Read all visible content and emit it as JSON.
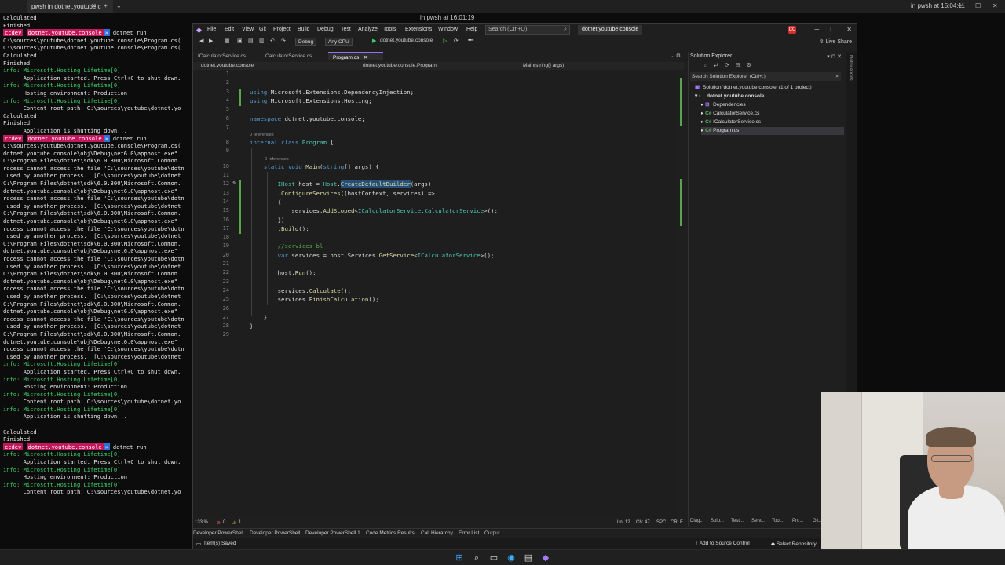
{
  "terminal": {
    "tab_title": "pwsh in dotnet.youtube.c",
    "mid_title": "in pwsh at 16:01:19",
    "right_title": "in pwsh at 15:04:11",
    "lines": [
      {
        "t": "Calculated"
      },
      {
        "t": "Finished"
      },
      {
        "t": "prompt",
        "a": "ccdev",
        "b": "dotnet.youtube.console",
        "c": "dotnet run"
      },
      {
        "t": "C:\\sources\\youtube\\dotnet.youtube.console\\Program.cs("
      },
      {
        "t": "C:\\sources\\youtube\\dotnet.youtube.console\\Program.cs("
      },
      {
        "t": "Calculated"
      },
      {
        "t": "Finished"
      },
      {
        "t": "info: Microsoft.Hosting.Lifetime[0]"
      },
      {
        "t": "      Application started. Press Ctrl+C to shut down."
      },
      {
        "t": "info: Microsoft.Hosting.Lifetime[0]"
      },
      {
        "t": "      Hosting environment: Production"
      },
      {
        "t": "info: Microsoft.Hosting.Lifetime[0]"
      },
      {
        "t": "      Content root path: C:\\sources\\youtube\\dotnet.yo"
      },
      {
        "t": "Calculated"
      },
      {
        "t": "Finished"
      },
      {
        "t": "      Application is shutting down..."
      },
      {
        "t": "prompt",
        "a": "ccdev",
        "b": "dotnet.youtube.console",
        "c": "dotnet run"
      },
      {
        "t": "C:\\sources\\youtube\\dotnet.youtube.console\\Program.cs("
      },
      {
        "t": "dotnet.youtube.console\\obj\\Debug\\net6.0\\apphost.exe\""
      },
      {
        "t": "C:\\Program Files\\dotnet\\sdk\\6.0.300\\Microsoft.Common."
      },
      {
        "t": "rocess cannot access the file 'C:\\sources\\youtube\\dotn"
      },
      {
        "t": " used by another process.  [C:\\sources\\youtube\\dotnet"
      },
      {
        "t": "C:\\Program Files\\dotnet\\sdk\\6.0.300\\Microsoft.Common."
      },
      {
        "t": "dotnet.youtube.console\\obj\\Debug\\net6.0\\apphost.exe\""
      },
      {
        "t": "rocess cannot access the file 'C:\\sources\\youtube\\dotn"
      },
      {
        "t": " used by another process.  [C:\\sources\\youtube\\dotnet"
      },
      {
        "t": "C:\\Program Files\\dotnet\\sdk\\6.0.300\\Microsoft.Common."
      },
      {
        "t": "dotnet.youtube.console\\obj\\Debug\\net6.0\\apphost.exe\""
      },
      {
        "t": "rocess cannot access the file 'C:\\sources\\youtube\\dotn"
      },
      {
        "t": " used by another process.  [C:\\sources\\youtube\\dotnet"
      },
      {
        "t": "C:\\Program Files\\dotnet\\sdk\\6.0.300\\Microsoft.Common."
      },
      {
        "t": "dotnet.youtube.console\\obj\\Debug\\net6.0\\apphost.exe\""
      },
      {
        "t": "rocess cannot access the file 'C:\\sources\\youtube\\dotn"
      },
      {
        "t": " used by another process.  [C:\\sources\\youtube\\dotnet"
      },
      {
        "t": "C:\\Program Files\\dotnet\\sdk\\6.0.300\\Microsoft.Common."
      },
      {
        "t": "dotnet.youtube.console\\obj\\Debug\\net6.0\\apphost.exe\""
      },
      {
        "t": "rocess cannot access the file 'C:\\sources\\youtube\\dotn"
      },
      {
        "t": " used by another process.  [C:\\sources\\youtube\\dotnet"
      },
      {
        "t": "C:\\Program Files\\dotnet\\sdk\\6.0.300\\Microsoft.Common."
      },
      {
        "t": "dotnet.youtube.console\\obj\\Debug\\net6.0\\apphost.exe\""
      },
      {
        "t": "rocess cannot access the file 'C:\\sources\\youtube\\dotn"
      },
      {
        "t": " used by another process.  [C:\\sources\\youtube\\dotnet"
      },
      {
        "t": "C:\\Program Files\\dotnet\\sdk\\6.0.300\\Microsoft.Common."
      },
      {
        "t": "dotnet.youtube.console\\obj\\Debug\\net6.0\\apphost.exe\""
      },
      {
        "t": "rocess cannot access the file 'C:\\sources\\youtube\\dotn"
      },
      {
        "t": " used by another process.  [C:\\sources\\youtube\\dotnet"
      },
      {
        "t": "info: Microsoft.Hosting.Lifetime[0]"
      },
      {
        "t": "      Application started. Press Ctrl+C to shut down."
      },
      {
        "t": "info: Microsoft.Hosting.Lifetime[0]"
      },
      {
        "t": "      Hosting environment: Production"
      },
      {
        "t": "info: Microsoft.Hosting.Lifetime[0]"
      },
      {
        "t": "      Content root path: C:\\sources\\youtube\\dotnet.yo"
      },
      {
        "t": "info: Microsoft.Hosting.Lifetime[0]"
      },
      {
        "t": "      Application is shutting down..."
      },
      {
        "t": ""
      },
      {
        "t": "Calculated"
      },
      {
        "t": "Finished"
      },
      {
        "t": "prompt",
        "a": "ccdev",
        "b": "dotnet.youtube.console",
        "c": "dotnet run"
      },
      {
        "t": "info: Microsoft.Hosting.Lifetime[0]"
      },
      {
        "t": "      Application started. Press Ctrl+C to shut down."
      },
      {
        "t": "info: Microsoft.Hosting.Lifetime[0]"
      },
      {
        "t": "      Hosting environment: Production"
      },
      {
        "t": "info: Microsoft.Hosting.Lifetime[0]"
      },
      {
        "t": "      Content root path: C:\\sources\\youtube\\dotnet.yo"
      }
    ]
  },
  "vs": {
    "menu": [
      "File",
      "Edit",
      "View",
      "Git",
      "Project",
      "Build",
      "Debug",
      "Test",
      "Analyze",
      "Tools",
      "Extensions",
      "Window",
      "Help"
    ],
    "search_placeholder": "Search (Ctrl+Q)",
    "solution_title": "dotnet.youtube.console",
    "badge": "CC",
    "live_share": "Live Share",
    "config": "Debug",
    "platform": "Any CPU",
    "run_target": "dotnet.youtube.console",
    "tabs": [
      "ICalculatorService.cs",
      "CalculatorService.cs",
      "Program.cs"
    ],
    "nav": {
      "project": "dotnet.youtube.console",
      "type": "dotnet.youtube.console.Program",
      "member": "Main(string[] args)"
    },
    "code_lines": [
      "",
      "",
      "using Microsoft.Extensions.DependencyInjection;",
      "using Microsoft.Extensions.Hosting;",
      "",
      "namespace dotnet.youtube.console;",
      "",
      "internal class Program {",
      "",
      "    static void Main(string[] args) {",
      "",
      "        IHost host = Host.CreateDefaultBuilder(args)",
      "        .ConfigureServices((hostContext, services) =>",
      "        {",
      "            services.AddScoped<ICalculatorService,CalculatorService>();",
      "        })",
      "        .Build();",
      "",
      "        //services bl",
      "        var services = host.Services.GetService<ICalculatorService>();",
      "",
      "        host.Run();",
      "",
      "        services.Calculate();",
      "        services.FinishCalculation();",
      "",
      "    }",
      "}",
      ""
    ],
    "codelens": [
      "0 references",
      "0 references"
    ],
    "status_editor": {
      "zoom": "133 %",
      "errors": "0",
      "warnings": "1",
      "ln": "Ln: 12",
      "ch": "Ch: 47",
      "spc": "SPC",
      "crlf": "CRLF"
    },
    "bottom_tabs": [
      "Developer PowerShell",
      "Developer PowerShell",
      "Developer PowerShell 1",
      "Code Metrics Results",
      "Call Hierarchy",
      "Error List",
      "Output"
    ],
    "status": {
      "left": "Item(s) Saved",
      "source": "Add to Source Control",
      "repo": "Select Repository"
    }
  },
  "solution_explorer": {
    "title": "Solution Explorer",
    "search": "Search Solution Explorer (Ctrl+;)",
    "items": [
      {
        "label": "Solution 'dotnet.youtube.console' (1 of 1 project)",
        "icon": "solution-icon"
      },
      {
        "label": "dotnet.youtube.console",
        "icon": "project-icon"
      },
      {
        "label": "Dependencies",
        "icon": "dependencies-icon"
      },
      {
        "label": "CalculatorService.cs",
        "icon": "csharp-file-icon"
      },
      {
        "label": "ICalculatorService.cs",
        "icon": "csharp-file-icon"
      },
      {
        "label": "Program.cs",
        "icon": "csharp-file-icon"
      }
    ],
    "bottom_tabs": [
      "Diag...",
      "Solu...",
      "Test...",
      "Serv...",
      "Tool...",
      "Pro...",
      "Git..."
    ],
    "side_label": "Notifications"
  },
  "colors": {
    "accent": "#9a6bff",
    "prompt_pink": "#c2185b",
    "prompt_blue": "#2f6fd6",
    "keyword": "#569cd6",
    "type": "#4ec9b0",
    "comment": "#57a64a"
  }
}
